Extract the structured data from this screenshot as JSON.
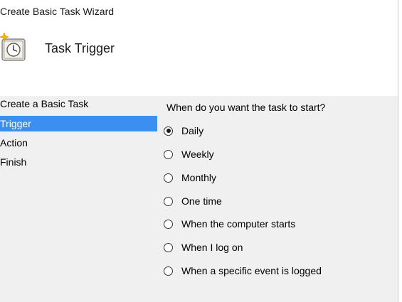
{
  "window": {
    "title": "Create Basic Task Wizard"
  },
  "header": {
    "title": "Task Trigger",
    "icon": "task-scheduler-clock-icon"
  },
  "steps": [
    {
      "label": "Create a Basic Task",
      "active": false
    },
    {
      "label": "Trigger",
      "active": true
    },
    {
      "label": "Action",
      "active": false
    },
    {
      "label": "Finish",
      "active": false
    }
  ],
  "content": {
    "question": "When do you want the task to start?",
    "options": [
      {
        "label": "Daily",
        "checked": true
      },
      {
        "label": "Weekly",
        "checked": false
      },
      {
        "label": "Monthly",
        "checked": false
      },
      {
        "label": "One time",
        "checked": false
      },
      {
        "label": "When the computer starts",
        "checked": false
      },
      {
        "label": "When I log on",
        "checked": false
      },
      {
        "label": "When a specific event is logged",
        "checked": false
      }
    ]
  },
  "colors": {
    "selection": "#3b8ff0",
    "panel_background": "#f0f0f0"
  }
}
